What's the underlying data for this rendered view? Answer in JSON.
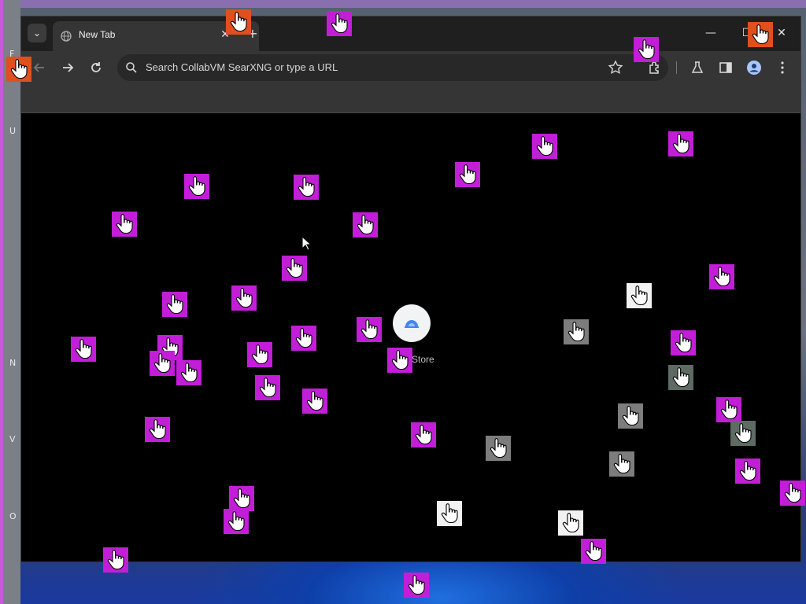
{
  "browser": {
    "tab_title": "New Tab",
    "tab_close": "✕",
    "new_tab": "+",
    "tab_search": "⌄",
    "window_controls": {
      "minimize": "—",
      "maximize": "☐",
      "close": "✕"
    },
    "omnibox_placeholder": "Search CollabVM SearXNG or type a URL",
    "shortcut_label": "Store"
  },
  "desktop": {
    "left_letters": [
      "F",
      "U",
      "N",
      "V",
      "O"
    ]
  },
  "colors": {
    "chrome_dark": "#1f1f1f",
    "chrome_toolbar": "#353535",
    "cursor_magenta": "#c21ed8",
    "page_bg": "#000000"
  },
  "icons": {
    "tab_favicon": "globe-icon",
    "back": "arrow-left-icon",
    "forward": "arrow-right-icon",
    "reload": "reload-icon",
    "omnibox": "search-icon",
    "bookmark": "star-icon",
    "extensions": "puzzle-icon",
    "labs": "flask-icon",
    "side_panel": "side-panel-icon",
    "profile": "profile-icon",
    "menu": "kebab-menu-icon",
    "remote_cursor": "hand-pointer-icon"
  }
}
